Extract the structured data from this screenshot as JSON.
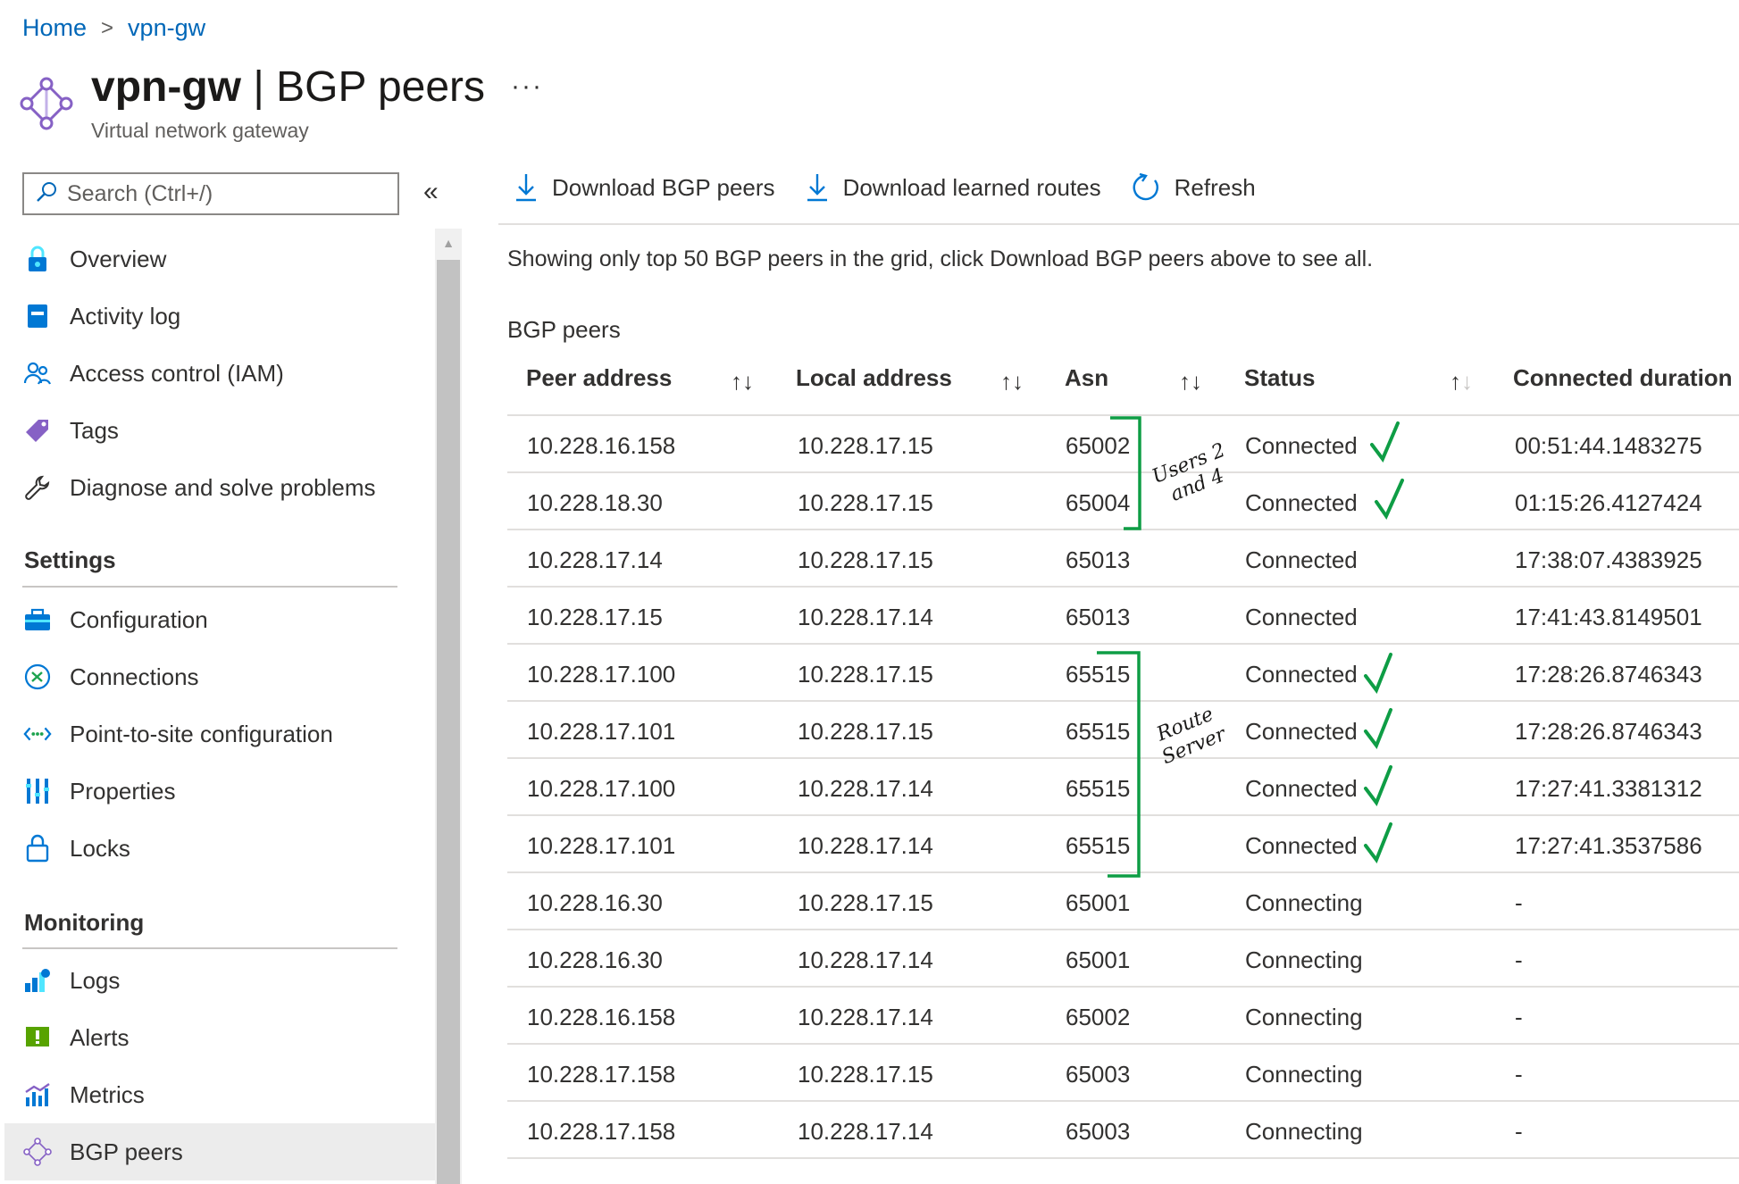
{
  "breadcrumb": {
    "home": "Home",
    "separator": ">",
    "current": "vpn-gw"
  },
  "header": {
    "title_bold": "vpn-gw",
    "title_rest": " | BGP peers",
    "more": "···",
    "subtitle": "Virtual network gateway",
    "icon": "network-gateway-icon"
  },
  "sidebar": {
    "search_placeholder": "Search (Ctrl+/)",
    "collapse": "«",
    "items": [
      {
        "label": "Overview",
        "icon": "overview-icon"
      },
      {
        "label": "Activity log",
        "icon": "activity-log-icon"
      },
      {
        "label": "Access control (IAM)",
        "icon": "people-icon"
      },
      {
        "label": "Tags",
        "icon": "tag-icon"
      },
      {
        "label": "Diagnose and solve problems",
        "icon": "wrench-icon"
      }
    ],
    "settings_header": "Settings",
    "settings_items": [
      {
        "label": "Configuration",
        "icon": "toolbox-icon"
      },
      {
        "label": "Connections",
        "icon": "connections-icon"
      },
      {
        "label": "Point-to-site configuration",
        "icon": "point-to-site-icon"
      },
      {
        "label": "Properties",
        "icon": "properties-icon"
      },
      {
        "label": "Locks",
        "icon": "lock-icon"
      }
    ],
    "monitoring_header": "Monitoring",
    "monitoring_items": [
      {
        "label": "Logs",
        "icon": "logs-icon"
      },
      {
        "label": "Alerts",
        "icon": "alert-icon"
      },
      {
        "label": "Metrics",
        "icon": "metrics-icon"
      },
      {
        "label": "BGP peers",
        "icon": "bgp-peers-icon",
        "selected": true
      }
    ]
  },
  "toolbar": {
    "download_peers": "Download BGP peers",
    "download_routes": "Download learned routes",
    "refresh": "Refresh"
  },
  "info_text": "Showing only top 50 BGP peers in the grid, click Download BGP peers above to see all.",
  "section_title": "BGP peers",
  "grid": {
    "columns": [
      "Peer address",
      "Local address",
      "Asn",
      "Status",
      "Connected duration"
    ],
    "sort_icon": "↑↓",
    "rows": [
      [
        "10.228.16.158",
        "10.228.17.15",
        "65002",
        "Connected",
        "00:51:44.1483275"
      ],
      [
        "10.228.18.30",
        "10.228.17.15",
        "65004",
        "Connected",
        "01:15:26.4127424"
      ],
      [
        "10.228.17.14",
        "10.228.17.15",
        "65013",
        "Connected",
        "17:38:07.4383925"
      ],
      [
        "10.228.17.15",
        "10.228.17.14",
        "65013",
        "Connected",
        "17:41:43.8149501"
      ],
      [
        "10.228.17.100",
        "10.228.17.15",
        "65515",
        "Connected",
        "17:28:26.8746343"
      ],
      [
        "10.228.17.101",
        "10.228.17.15",
        "65515",
        "Connected",
        "17:28:26.8746343"
      ],
      [
        "10.228.17.100",
        "10.228.17.14",
        "65515",
        "Connected",
        "17:27:41.3381312"
      ],
      [
        "10.228.17.101",
        "10.228.17.14",
        "65515",
        "Connected",
        "17:27:41.3537586"
      ],
      [
        "10.228.16.30",
        "10.228.17.15",
        "65001",
        "Connecting",
        "-"
      ],
      [
        "10.228.16.30",
        "10.228.17.14",
        "65001",
        "Connecting",
        "-"
      ],
      [
        "10.228.16.158",
        "10.228.17.14",
        "65002",
        "Connecting",
        "-"
      ],
      [
        "10.228.17.158",
        "10.228.17.15",
        "65003",
        "Connecting",
        "-"
      ],
      [
        "10.228.17.158",
        "10.228.17.14",
        "65003",
        "Connecting",
        "-"
      ]
    ]
  },
  "annotations": {
    "users_note_line1": "Users 2",
    "users_note_line2": "and 4",
    "route_server_line1": "Route",
    "route_server_line2": "Server",
    "bracket_color": "#0e9d45",
    "check_color": "#0e9d45"
  },
  "colors": {
    "link": "#0067b8",
    "text": "#323130",
    "accent_purple": "#8661c5",
    "azure_blue": "#0078d4"
  }
}
